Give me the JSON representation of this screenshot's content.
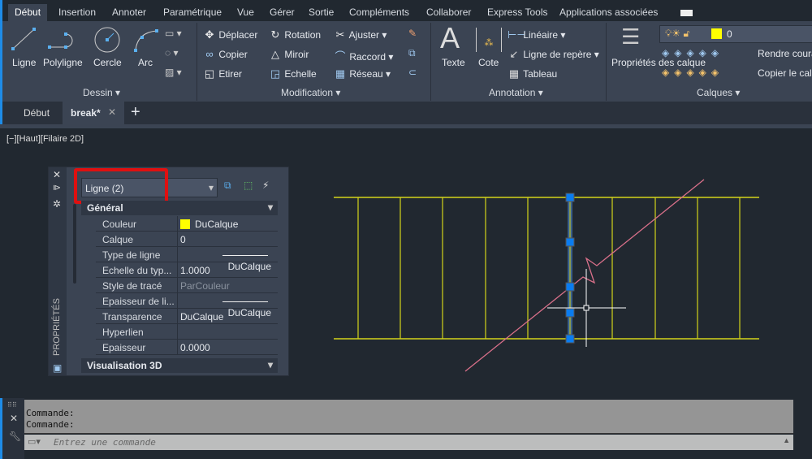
{
  "menu_tabs": [
    "Début",
    "Insertion",
    "Annoter",
    "Paramétrique",
    "Vue",
    "Gérer",
    "Sortie",
    "Compléments",
    "Collaborer",
    "Express Tools",
    "Applications associées"
  ],
  "ribbon": {
    "dessin": {
      "title": "Dessin",
      "items": [
        "Ligne",
        "Polyligne",
        "Cercle",
        "Arc"
      ]
    },
    "modification": {
      "title": "Modification",
      "items": [
        "Déplacer",
        "Rotation",
        "Ajuster",
        "Copier",
        "Miroir",
        "Raccord",
        "Etirer",
        "Echelle",
        "Réseau"
      ]
    },
    "annotation": {
      "title": "Annotation",
      "items": [
        "Texte",
        "Cote",
        "Linéaire",
        "Ligne de repère",
        "Tableau"
      ]
    },
    "calques": {
      "title": "Calques",
      "layer_props": "Propriétés des calque",
      "current_layer": "0",
      "layer_color": "#ffff00",
      "make_current": "Rendre coura",
      "copy_layer": "Copier le calc"
    }
  },
  "doc_tabs": [
    "Début",
    "break*"
  ],
  "viewport_label": "[−][Haut][Filaire 2D]",
  "properties": {
    "selection": "Ligne (2)",
    "palette_title": "PROPRIÉTÉS",
    "section_general": "Général",
    "section_3d": "Visualisation 3D",
    "rows": [
      {
        "key": "Couleur",
        "value": "DuCalque",
        "swatch": "#ffff00"
      },
      {
        "key": "Calque",
        "value": "0"
      },
      {
        "key": "Type de ligne",
        "value": "DuCalque",
        "line": true
      },
      {
        "key": "Echelle du typ...",
        "value": "1.0000"
      },
      {
        "key": "Style de tracé",
        "value": "ParCouleur",
        "dim": true
      },
      {
        "key": "Epaisseur de li...",
        "value": "DuCalque",
        "line": true
      },
      {
        "key": "Transparence",
        "value": "DuCalque"
      },
      {
        "key": "Hyperlien",
        "value": ""
      },
      {
        "key": "Epaisseur",
        "value": "0.0000"
      }
    ]
  },
  "command": {
    "history": [
      "Commande:",
      "Commande:"
    ],
    "placeholder": "Entrez une commande"
  },
  "colors": {
    "accent": "#1e8ce8",
    "drawing_lines": "#d4d41a",
    "break_line": "#d9708a",
    "grip": "#0a7cf0",
    "highlight": "#ff0000"
  }
}
